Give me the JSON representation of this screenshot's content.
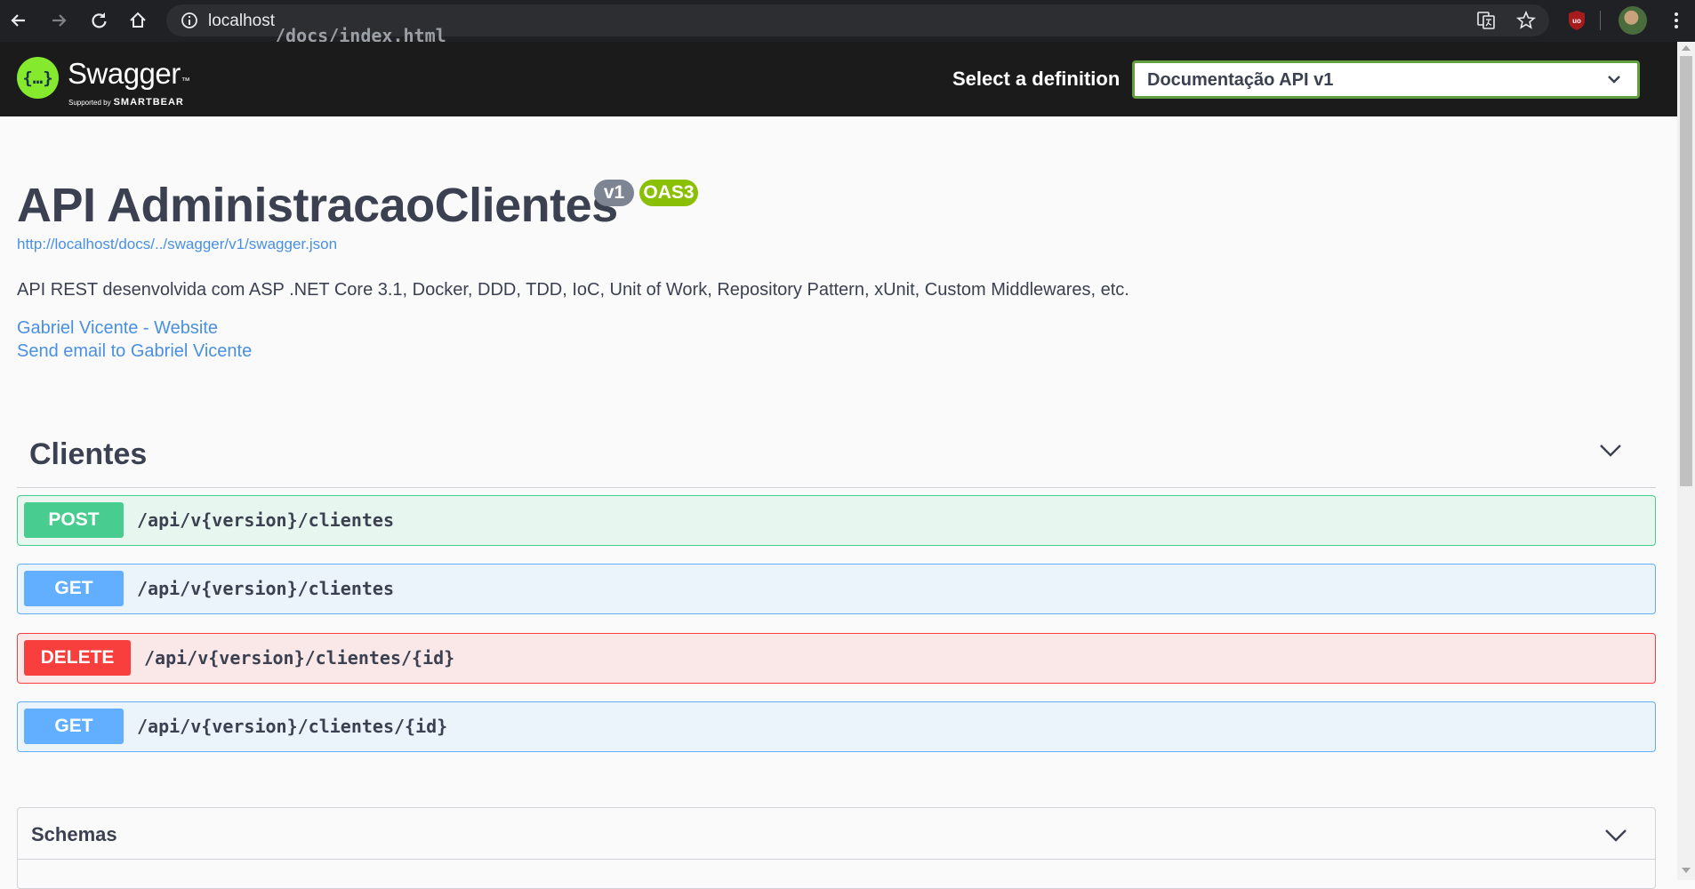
{
  "browser": {
    "url_host": "localhost",
    "url_path": "/docs/index.html",
    "extension_label": "uo"
  },
  "topbar": {
    "logo_glyph": "{…}",
    "logo_name": "Swagger",
    "logo_tm": "™",
    "logo_supported_by": "Supported by",
    "logo_smartbear": "SMARTBEAR",
    "select_label": "Select a definition",
    "selected_definition": "Documentação API v1"
  },
  "info": {
    "title": "API AdministracaoClientes",
    "version_badge": "v1",
    "oas_badge": "OAS3",
    "spec_url": "http://localhost/docs/../swagger/v1/swagger.json",
    "description": "API REST desenvolvida com ASP .NET Core 3.1, Docker, DDD, TDD, IoC, Unit of Work, Repository Pattern, xUnit, Custom Middlewares, etc.",
    "website_link": "Gabriel Vicente - Website",
    "email_link": "Send email to Gabriel Vicente"
  },
  "tag": {
    "name": "Clientes",
    "operations": [
      {
        "method": "POST",
        "path": "/api/v{version}/clientes"
      },
      {
        "method": "GET",
        "path": "/api/v{version}/clientes"
      },
      {
        "method": "DELETE",
        "path": "/api/v{version}/clientes/{id}"
      },
      {
        "method": "GET",
        "path": "/api/v{version}/clientes/{id}"
      }
    ]
  },
  "schemas": {
    "title": "Schemas"
  },
  "colors": {
    "post": "#49cc90",
    "get": "#61affe",
    "delete": "#f93e3e",
    "swagger_green": "#85ea2d",
    "link": "#4990e2"
  }
}
